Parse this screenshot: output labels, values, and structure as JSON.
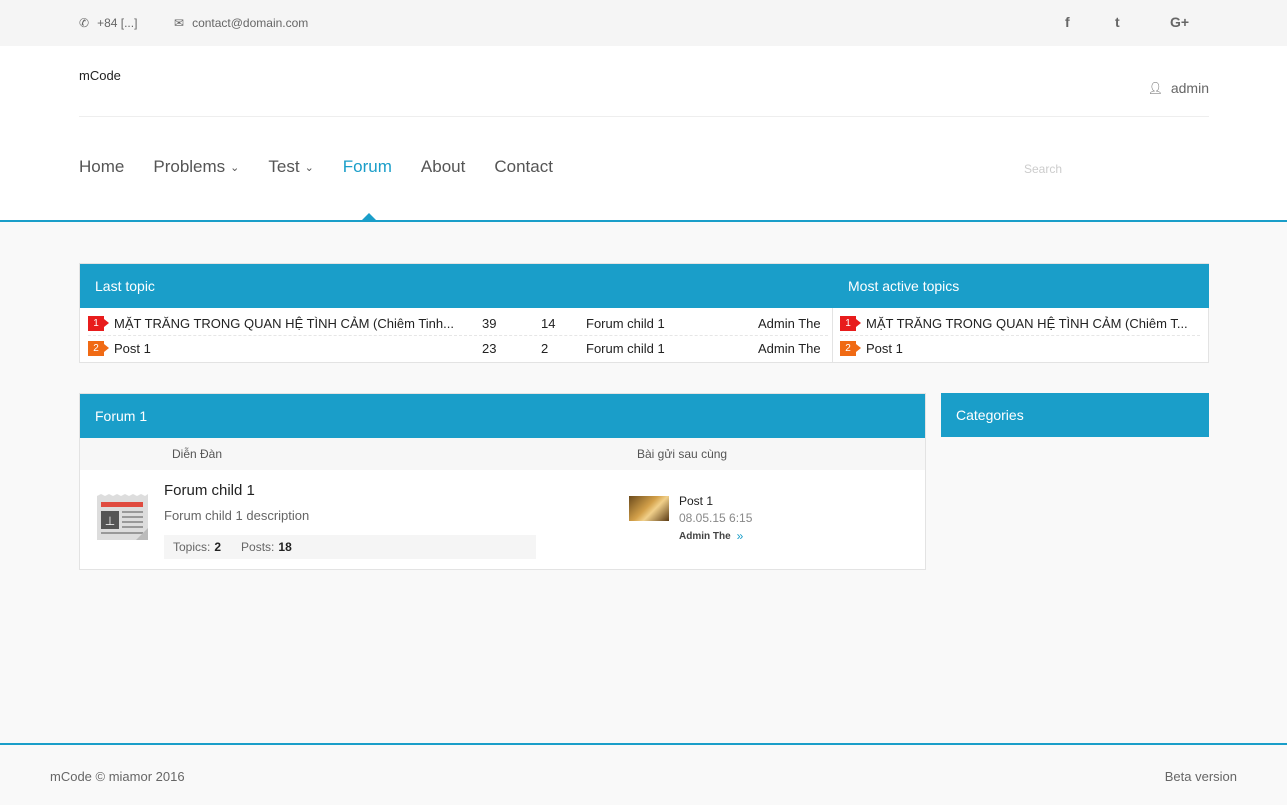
{
  "topbar": {
    "phone": "+84 [...]",
    "email": "contact@domain.com",
    "social": [
      "f",
      "t",
      "G+"
    ]
  },
  "header": {
    "logo": "mCode",
    "user": "admin"
  },
  "nav": {
    "items": [
      "Home",
      "Problems",
      "Test",
      "Forum",
      "About",
      "Contact"
    ],
    "search_placeholder": "Search"
  },
  "last_topic": {
    "title": "Last topic",
    "rows": [
      {
        "rank": "1",
        "title": "MẶT TRĂNG TRONG QUAN HỆ TÌNH CẢM (Chiêm Tinh...",
        "views": "39",
        "replies": "14",
        "forum": "Forum child 1",
        "author": "Admin The"
      },
      {
        "rank": "2",
        "title": "Post 1",
        "views": "23",
        "replies": "2",
        "forum": "Forum child 1",
        "author": "Admin The"
      }
    ]
  },
  "most_active": {
    "title": "Most active topics",
    "rows": [
      {
        "rank": "1",
        "title": "MẶT TRĂNG TRONG QUAN HỆ TÌNH CẢM (Chiêm T..."
      },
      {
        "rank": "2",
        "title": "Post 1"
      }
    ]
  },
  "forum": {
    "title": "Forum 1",
    "col_forum": "Diễn Đàn",
    "col_last": "Bài gửi sau cùng",
    "child": {
      "name": "Forum child 1",
      "desc": "Forum child 1 description",
      "topics_label": "Topics:",
      "topics": "2",
      "posts_label": "Posts:",
      "posts": "18",
      "last_post": "Post 1",
      "last_date": "08.05.15 6:15",
      "last_author": "Admin The"
    }
  },
  "categories": {
    "title": "Categories"
  },
  "footer": {
    "left": "mCode © miamor 2016",
    "right": "Beta version"
  },
  "colors": {
    "accent": "#1a9ec9",
    "rank1": "#e81c1c",
    "rank2": "#f06a14"
  }
}
